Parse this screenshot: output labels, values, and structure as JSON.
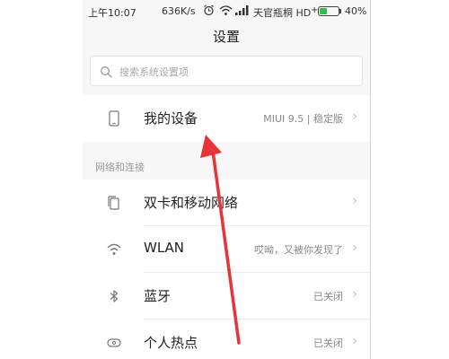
{
  "status_bar": {
    "time": "上午10:07",
    "net_speed": "636K/s",
    "carrier": "天官瓶桐 HD",
    "charging": "+",
    "battery_level": 0.4,
    "battery_text": "40%"
  },
  "header": {
    "title": "设置"
  },
  "search": {
    "placeholder": "搜索系统设置项"
  },
  "my_device": {
    "label": "我的设备",
    "value": "MIUI 9.5 | 稳定版"
  },
  "network_section": {
    "title": "网络和连接"
  },
  "rows": [
    {
      "label": "双卡和移动网络",
      "value": ""
    },
    {
      "label": "WLAN",
      "value": "哎呦，又被你发现了"
    },
    {
      "label": "蓝牙",
      "value": "已关闭"
    },
    {
      "label": "个人热点",
      "value": "已关闭"
    }
  ],
  "icons": {
    "status": [
      "alarm-icon",
      "wifi-icon",
      "signal-icon",
      "battery-icon"
    ],
    "rows": [
      "phone-icon",
      "sim-card-icon",
      "wifi-icon",
      "bluetooth-icon",
      "hotspot-icon"
    ],
    "search": "search-icon",
    "chevron": "chevron-right-icon"
  },
  "colors": {
    "annotation_arrow": "#e8333a",
    "battery_fill": "#2fbf4a",
    "page_bg": "#f7f7f7"
  }
}
